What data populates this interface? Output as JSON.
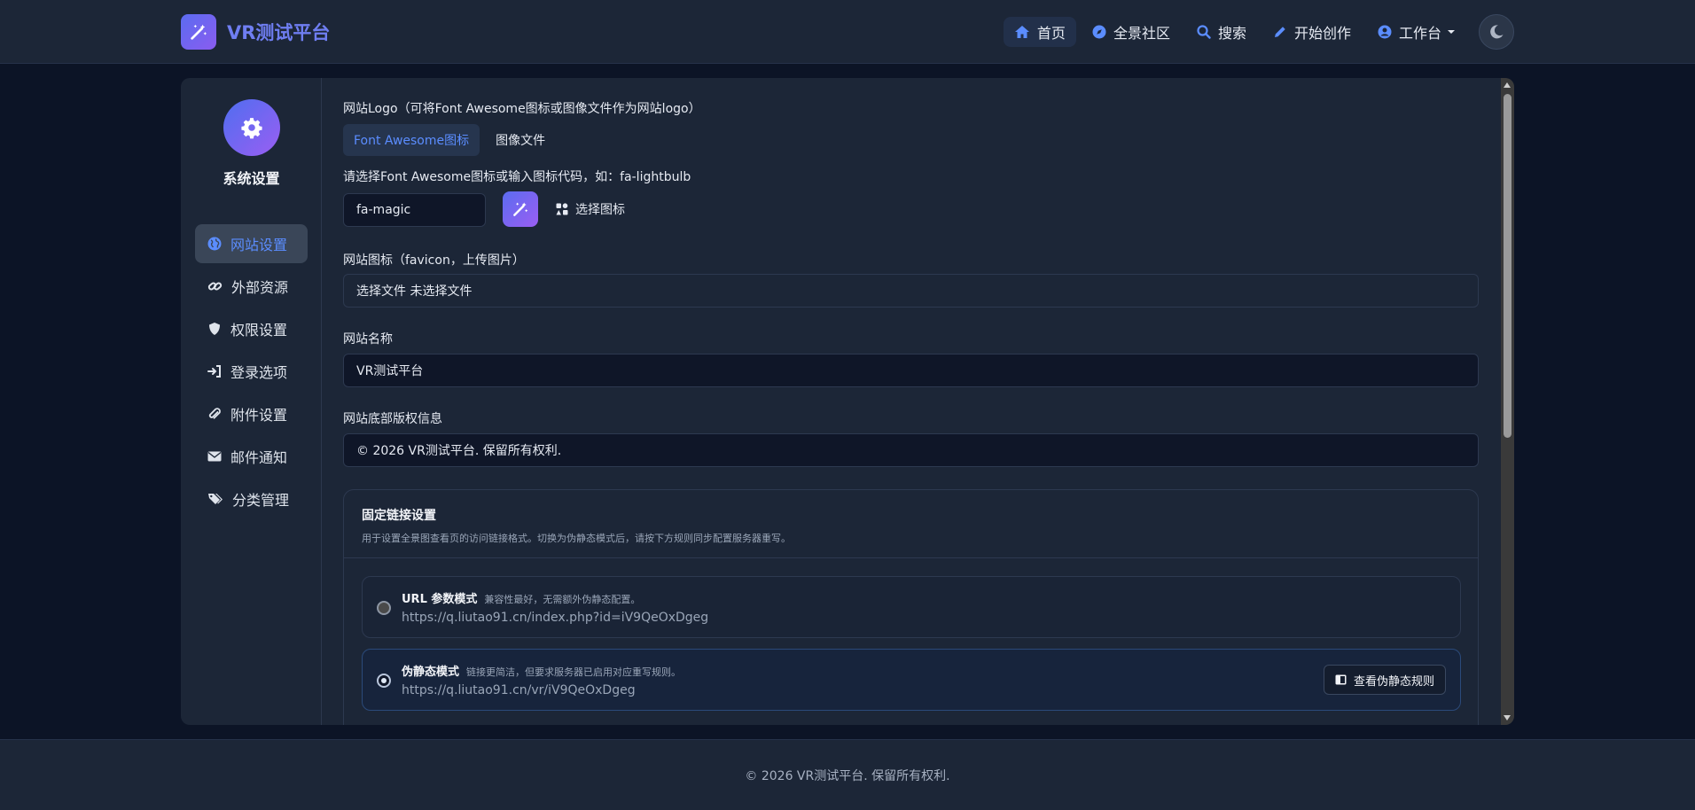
{
  "brand": {
    "name": "VR测试平台",
    "logo_icon": "magic-wand-icon"
  },
  "nav": {
    "items": [
      {
        "label": "首页",
        "icon": "home-icon",
        "active": true
      },
      {
        "label": "全景社区",
        "icon": "compass-icon"
      },
      {
        "label": "搜索",
        "icon": "search-icon"
      },
      {
        "label": "开始创作",
        "icon": "pencil-icon"
      },
      {
        "label": "工作台",
        "icon": "user-circle-icon",
        "dropdown": true
      }
    ],
    "theme_toggle_icon": "moon-icon"
  },
  "sidebar": {
    "title": "系统设置",
    "avatar_icon": "gear-icon",
    "items": [
      {
        "label": "网站设置",
        "icon": "globe-icon",
        "active": true
      },
      {
        "label": "外部资源",
        "icon": "link-icon"
      },
      {
        "label": "权限设置",
        "icon": "shield-icon"
      },
      {
        "label": "登录选项",
        "icon": "sign-in-icon"
      },
      {
        "label": "附件设置",
        "icon": "paperclip-icon"
      },
      {
        "label": "邮件通知",
        "icon": "envelope-icon"
      },
      {
        "label": "分类管理",
        "icon": "tags-icon"
      }
    ]
  },
  "form": {
    "logo_label": "网站Logo（可将Font Awesome图标或图像文件作为网站logo）",
    "logo_tabs": [
      {
        "label": "Font Awesome图标",
        "active": true
      },
      {
        "label": "图像文件"
      }
    ],
    "icon_hint": "请选择Font Awesome图标或输入图标代码，如：fa-lightbulb",
    "icon_value": "fa-magic",
    "choose_icon_label": "选择图标",
    "favicon_label": "网站图标（favicon，上传图片）",
    "favicon_file_text": "选择文件 未选择文件",
    "site_name_label": "网站名称",
    "site_name_value": "VR测试平台",
    "copyright_label": "网站底部版权信息",
    "copyright_value": "© 2026 VR测试平台. 保留所有权利."
  },
  "permalink": {
    "title": "固定链接设置",
    "description": "用于设置全景图查看页的访问链接格式。切换为伪静态模式后，请按下方规则同步配置服务器重写。",
    "options": [
      {
        "title": "URL 参数模式",
        "note": "兼容性最好，无需额外伪静态配置。",
        "url": "https://q.liutao91.cn/index.php?id=iV9QeOxDgeg",
        "selected": false
      },
      {
        "title": "伪静态模式",
        "note": "链接更简洁，但要求服务器已启用对应重写规则。",
        "url": "https://q.liutao91.cn/vr/iV9QeOxDgeg",
        "selected": true,
        "button": "查看伪静态规则"
      }
    ]
  },
  "footer": {
    "text": "© 2026 VR测试平台. 保留所有权利."
  },
  "colors": {
    "accent": "#5b8dff",
    "brand": "#6f7ef2",
    "background": "#0c1426",
    "panel": "#1c2637"
  }
}
